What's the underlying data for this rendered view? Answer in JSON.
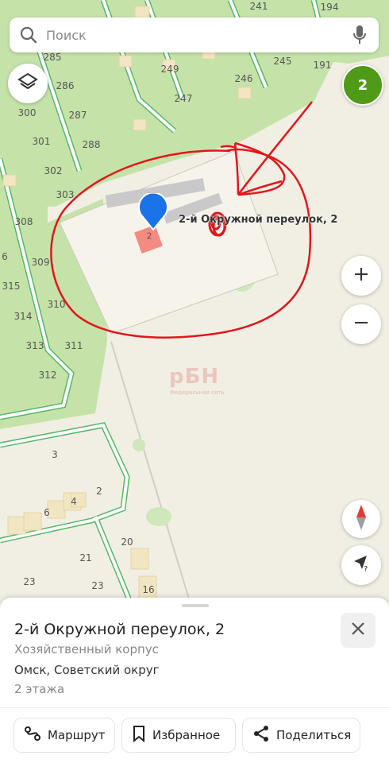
{
  "search": {
    "placeholder": "Поиск"
  },
  "badge": {
    "count": "2"
  },
  "map": {
    "house_numbers": [
      "241",
      "194",
      "285",
      "249",
      "245",
      "191",
      "286",
      "246",
      "300",
      "287",
      "247",
      "301",
      "288",
      "302",
      "303",
      "308",
      "309",
      "6",
      "315",
      "310",
      "314",
      "313",
      "311",
      "312",
      "3",
      "4",
      "2",
      "6",
      "20",
      "21",
      "23",
      "23",
      "16"
    ],
    "address_label": "2-й Окружной переулок, 2",
    "building_number": "2",
    "watermark": "рБН",
    "watermark_sub": "Федеральная сеть"
  },
  "place_card": {
    "title": "2-й Окружной переулок, 2",
    "category": "Хозяйственный корпус",
    "locality": "Омск, Советский округ",
    "floors": "2 этажа"
  },
  "actions": {
    "route": "Маршрут",
    "favorites": "Избранное",
    "share": "Поделиться"
  },
  "colors": {
    "accent_green": "#4f9b17",
    "pin_blue": "#1a73e8",
    "annotation_red": "#e3161b"
  }
}
